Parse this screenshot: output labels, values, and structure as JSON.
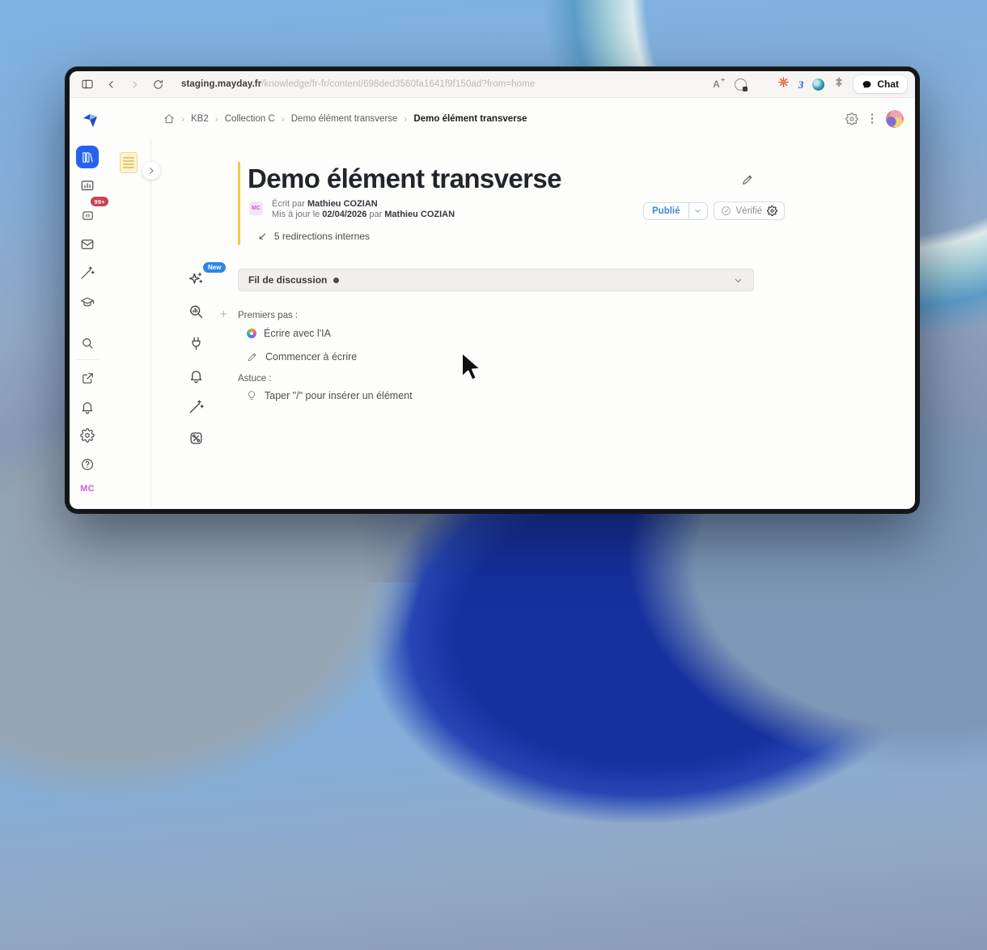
{
  "colors": {
    "accent": "#2563eb",
    "publish": "#4186d8",
    "badge": "#c94355",
    "newbadge": "#2e86e5",
    "mc": "#c65fd4",
    "ybar": "#f2c94c"
  },
  "browser": {
    "url_host": "staging.mayday.fr",
    "url_path": "/knowledge/fr-fr/content/698ded3560fa1641f9f150ad?from=home",
    "chat_label": "Chat",
    "text_size_glyph": "A",
    "extension_three_glyph": "3"
  },
  "header": {
    "separator": "›",
    "breadcrumb": [
      "KB2",
      "Collection C",
      "Demo élément transverse",
      "Demo élément transverse"
    ]
  },
  "nav": {
    "badge_count": "99+",
    "avatar_initials": "MC"
  },
  "tools": {
    "new_badge": "New"
  },
  "article": {
    "title": "Demo élément transverse",
    "status_label": "Publié",
    "verified_label": "Vérifié",
    "written_prefix": "Écrit par",
    "author": "Mathieu COZIAN",
    "updated_prefix": "Mis à jour le",
    "updated_date": "02/04/2026",
    "by_word": "par",
    "updated_author": "Mathieu COZIAN",
    "meta_avatar_initials": "MC",
    "redirections_arrow": "↙",
    "redirections_text": "5 redirections internes",
    "thread_label": "Fil de discussion"
  },
  "editor": {
    "plus_glyph": "+",
    "first_steps_label": "Premiers pas :",
    "ai_option": "Écrire avec l'IA",
    "write_option": "Commencer à écrire",
    "tip_label": "Astuce :",
    "tip_text": "Taper \"/\" pour insérer un élément"
  }
}
